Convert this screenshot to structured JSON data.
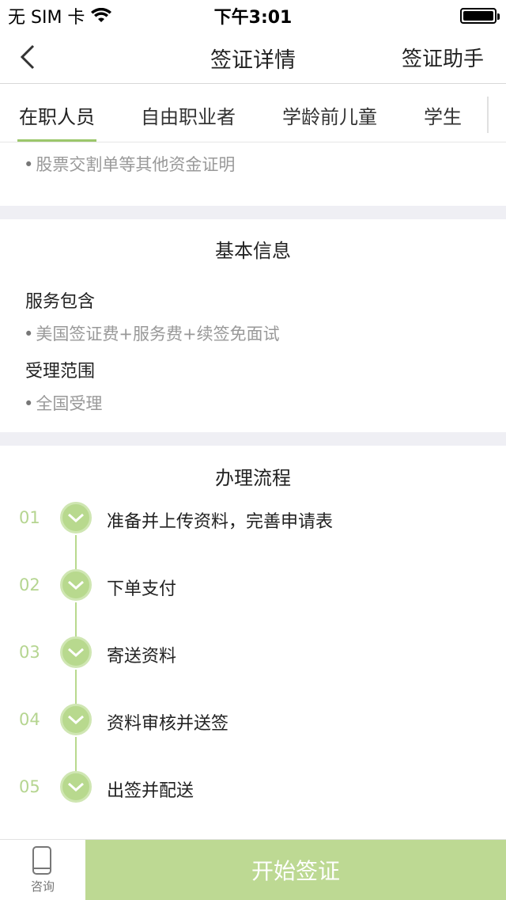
{
  "status": {
    "carrier": "无 SIM 卡",
    "time": "下午3:01"
  },
  "nav": {
    "title": "签证详情",
    "right": "签证助手"
  },
  "tabs": [
    "在职人员",
    "自由职业者",
    "学龄前儿童",
    "学生"
  ],
  "partial": {
    "text": "股票交割单等其他资金证明"
  },
  "basic": {
    "title": "基本信息",
    "service_label": "服务包含",
    "service_value": "美国签证费+服务费+续签免面试",
    "scope_label": "受理范围",
    "scope_value": "全国受理"
  },
  "process": {
    "title": "办理流程",
    "steps": [
      {
        "num": "01",
        "text": "准备并上传资料，完善申请表"
      },
      {
        "num": "02",
        "text": "下单支付"
      },
      {
        "num": "03",
        "text": "寄送资料"
      },
      {
        "num": "04",
        "text": "资料审核并送签"
      },
      {
        "num": "05",
        "text": "出签并配送"
      }
    ]
  },
  "bottom": {
    "consult_label": "咨询",
    "start_label": "开始签证"
  },
  "colors": {
    "accent": "#9cc76b",
    "button": "#bdd993",
    "gap": "#efeff4"
  }
}
